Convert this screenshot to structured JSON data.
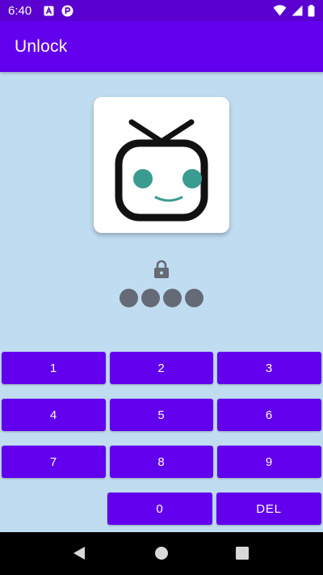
{
  "status_bar": {
    "time": "6:40",
    "left_icons": [
      "text-a-icon",
      "notification-p-icon"
    ],
    "right_icons": [
      "wifi-icon",
      "signal-icon",
      "battery-icon"
    ]
  },
  "app_bar": {
    "title": "Unlock"
  },
  "logo": {
    "icon": "tv-robot-icon"
  },
  "lock": {
    "icon": "lock-icon"
  },
  "pin": {
    "entered_digits": 4
  },
  "keypad": {
    "rows": [
      [
        "1",
        "2",
        "3"
      ],
      [
        "4",
        "5",
        "6"
      ],
      [
        "7",
        "8",
        "9"
      ],
      [
        "0",
        "DEL"
      ]
    ]
  },
  "nav_bar": {
    "buttons": [
      "back-icon",
      "home-icon",
      "recents-icon"
    ]
  },
  "colors": {
    "status_bar": "#5a00d0",
    "app_bar": "#6200ee",
    "background": "#c0dcf0",
    "button": "#6200ee",
    "pin_dot": "#646a76",
    "logo_eye": "#3a9b90"
  }
}
